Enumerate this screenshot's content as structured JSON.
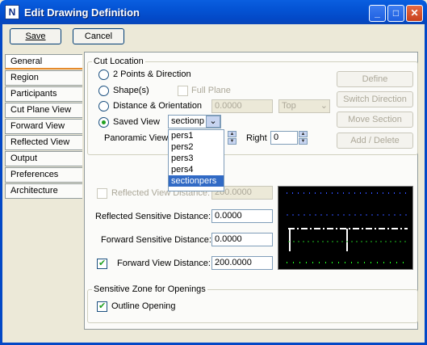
{
  "window": {
    "title": "Edit Drawing Definition",
    "app_icon_glyph": "N"
  },
  "toolbar": {
    "save_label": "Save",
    "cancel_label": "Cancel"
  },
  "tabs": [
    "General",
    "Region",
    "Participants",
    "Cut Plane View",
    "Forward View",
    "Reflected View",
    "Output",
    "Preferences",
    "Architecture"
  ],
  "cut_location": {
    "legend": "Cut Location",
    "opt_2points": "2 Points & Direction",
    "opt_shapes": "Shape(s)",
    "full_plane": "Full Plane",
    "opt_distance": "Distance & Orientation",
    "distance_value": "0.0000",
    "orientation_value": "Top",
    "opt_saved_view": "Saved View",
    "saved_view_value": "sectionp",
    "panoramic_label": "Panoramic Views",
    "right_label": "Right",
    "right_value": "0",
    "saved_view_options": [
      "pers1",
      "pers2",
      "pers3",
      "pers4",
      "sectionpers"
    ],
    "selected_option": "sectionpers"
  },
  "side_buttons": {
    "define": "Define",
    "switch_direction": "Switch Direction",
    "move_section": "Move Section",
    "add_delete": "Add / Delete"
  },
  "distances": {
    "reflected_view_label": "Reflected View Distance:",
    "reflected_view_value": "200.0000",
    "reflected_sensitive_label": "Reflected Sensitive Distance:",
    "reflected_sensitive_value": "0.0000",
    "forward_sensitive_label": "Forward Sensitive Distance:",
    "forward_sensitive_value": "0.0000",
    "forward_view_label": "Forward View Distance:",
    "forward_view_value": "200.0000"
  },
  "openings": {
    "legend": "Sensitive Zone for Openings",
    "outline_label": "Outline Opening"
  },
  "colors": {
    "accent": "#e68b2c",
    "title_blue": "#0453d4",
    "selection": "#316ac5"
  }
}
